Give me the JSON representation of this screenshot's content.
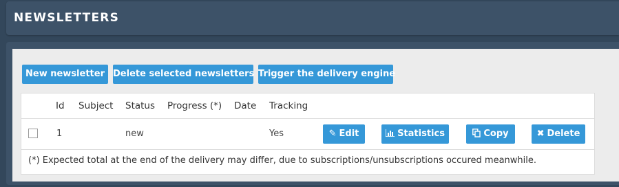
{
  "header": {
    "title": "NEWSLETTERS"
  },
  "toolbar": {
    "new_label": "New newsletter",
    "delete_selected_label": "Delete selected newsletters",
    "trigger_label": "Trigger the delivery engine"
  },
  "table": {
    "columns": [
      "Id",
      "Subject",
      "Status",
      "Progress (*)",
      "Date",
      "Tracking"
    ],
    "rows": [
      {
        "id": "1",
        "subject": "",
        "status": "new",
        "progress": "",
        "date": "",
        "tracking": "Yes",
        "actions": {
          "edit": "Edit",
          "statistics": "Statistics",
          "copy": "Copy",
          "delete": "Delete"
        }
      }
    ],
    "footnote": "(*) Expected total at the end of the delivery may differ, due to subscriptions/unsubscriptions occured meanwhile."
  },
  "icons": {
    "edit": "pencil-icon",
    "statistics": "bar-chart-icon",
    "copy": "copy-icon",
    "delete": "close-icon"
  },
  "colors": {
    "background": "#33475b",
    "header": "#3d5268",
    "button": "#3598d8",
    "panel": "#ececec"
  }
}
